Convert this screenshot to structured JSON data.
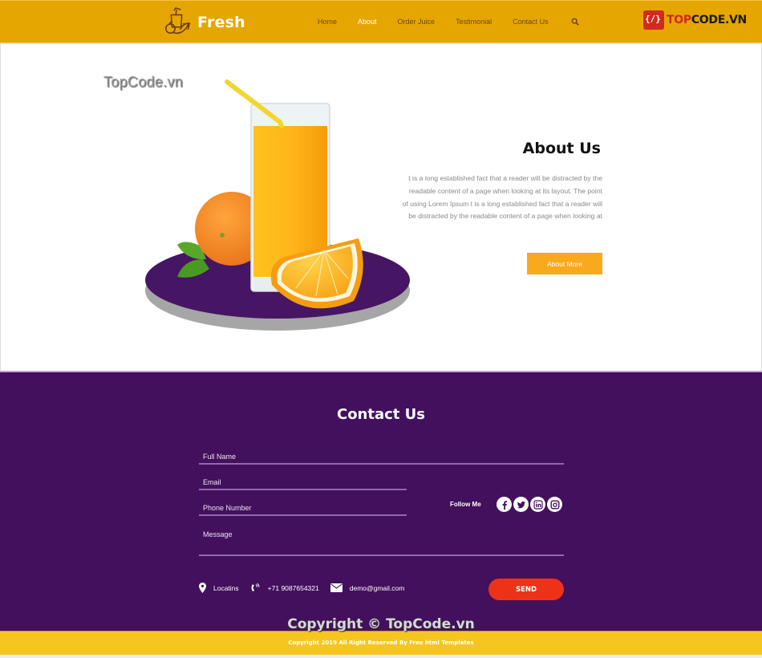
{
  "header": {
    "brand_name": "Fresh",
    "nav": [
      {
        "label": "Home",
        "active": false
      },
      {
        "label": "About",
        "active": true
      },
      {
        "label": "Order Juice",
        "active": false
      },
      {
        "label": "Testimonial",
        "active": false
      },
      {
        "label": "Contact Us",
        "active": false
      }
    ],
    "search_icon": "search-icon",
    "badge": {
      "prefix": "TOP",
      "suffix": "CODE.VN"
    }
  },
  "about": {
    "watermark": "TopCode.vn",
    "title": "About Us",
    "text": "t is a long established fact that a reader will be distracted by the readable content of a page when looking at its layout. The point of using Lorem Ipsum t is a long established fact that a reader will be distracted by the readable content of a page when looking at",
    "button_label": "About More"
  },
  "contact": {
    "title": "Contact Us",
    "fields": {
      "full_name": {
        "placeholder": "Full Name",
        "value": ""
      },
      "email": {
        "placeholder": "Email",
        "value": ""
      },
      "phone": {
        "placeholder": "Phone Number",
        "value": ""
      },
      "message": {
        "placeholder": "Message",
        "value": ""
      }
    },
    "follow_label": "Follow Me",
    "socials": [
      "facebook-icon",
      "twitter-icon",
      "linkedin-icon",
      "instagram-icon"
    ],
    "info": {
      "location": "Locatins",
      "phone": "+71 9087654321",
      "email": "demo@gmail.com"
    },
    "send_label": "SEND",
    "watermark": "Copyright © TopCode.vn"
  },
  "footer": {
    "text": "Copyright 2019 All Right Reserved By Free html Templates"
  },
  "colors": {
    "header_bg": "#e6a602",
    "accent_orange": "#f9a91c",
    "contact_bg": "#43105d",
    "send_red": "#ee3218",
    "footer_bg": "#f5c61f"
  }
}
